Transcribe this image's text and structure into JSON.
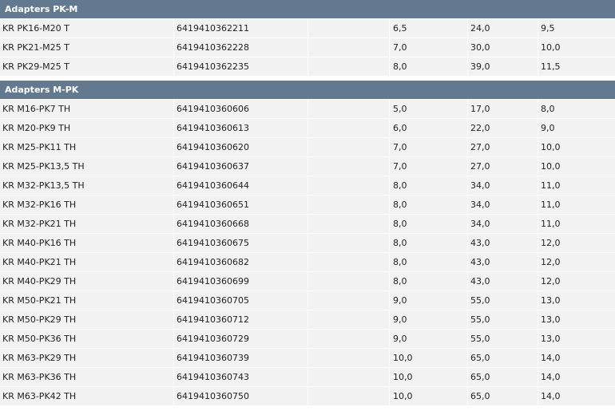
{
  "sections": [
    {
      "title": "Adapters PK-M",
      "rows": [
        {
          "name": "KR PK16-M20 T",
          "code": "6419410362211",
          "empty": "",
          "v1": "6,5",
          "v2": "24,0",
          "v3": "9,5"
        },
        {
          "name": "KR PK21-M25 T",
          "code": "6419410362228",
          "empty": "",
          "v1": "7,0",
          "v2": "30,0",
          "v3": "10,0"
        },
        {
          "name": "KR PK29-M25 T",
          "code": "6419410362235",
          "empty": "",
          "v1": "8,0",
          "v2": "39,0",
          "v3": "11,5"
        }
      ]
    },
    {
      "title": "Adapters M-PK",
      "rows": [
        {
          "name": "KR M16-PK7 TH",
          "code": "6419410360606",
          "empty": "",
          "v1": "5,0",
          "v2": "17,0",
          "v3": "8,0"
        },
        {
          "name": "KR M20-PK9 TH",
          "code": "6419410360613",
          "empty": "",
          "v1": "6,0",
          "v2": "22,0",
          "v3": "9,0"
        },
        {
          "name": "KR M25-PK11 TH",
          "code": "6419410360620",
          "empty": "",
          "v1": "7,0",
          "v2": "27,0",
          "v3": "10,0"
        },
        {
          "name": "KR M25-PK13,5 TH",
          "code": "6419410360637",
          "empty": "",
          "v1": "7,0",
          "v2": "27,0",
          "v3": "10,0"
        },
        {
          "name": "KR M32-PK13,5 TH",
          "code": "6419410360644",
          "empty": "",
          "v1": "8,0",
          "v2": "34,0",
          "v3": "11,0"
        },
        {
          "name": "KR M32-PK16 TH",
          "code": "6419410360651",
          "empty": "",
          "v1": "8,0",
          "v2": "34,0",
          "v3": "11,0"
        },
        {
          "name": "KR M32-PK21 TH",
          "code": "6419410360668",
          "empty": "",
          "v1": "8,0",
          "v2": "34,0",
          "v3": "11,0"
        },
        {
          "name": "KR M40-PK16 TH",
          "code": "6419410360675",
          "empty": "",
          "v1": "8,0",
          "v2": "43,0",
          "v3": "12,0"
        },
        {
          "name": "KR M40-PK21 TH",
          "code": "6419410360682",
          "empty": "",
          "v1": "8,0",
          "v2": "43,0",
          "v3": "12,0"
        },
        {
          "name": "KR M40-PK29 TH",
          "code": "6419410360699",
          "empty": "",
          "v1": "8,0",
          "v2": "43,0",
          "v3": "12,0"
        },
        {
          "name": "KR M50-PK21 TH",
          "code": "6419410360705",
          "empty": "",
          "v1": "9,0",
          "v2": "55,0",
          "v3": "13,0"
        },
        {
          "name": "KR M50-PK29 TH",
          "code": "6419410360712",
          "empty": "",
          "v1": "9,0",
          "v2": "55,0",
          "v3": "13,0"
        },
        {
          "name": "KR M50-PK36 TH",
          "code": "6419410360729",
          "empty": "",
          "v1": "9,0",
          "v2": "55,0",
          "v3": "13,0"
        },
        {
          "name": "KR M63-PK29 TH",
          "code": "6419410360739",
          "empty": "",
          "v1": "10,0",
          "v2": "65,0",
          "v3": "14,0"
        },
        {
          "name": "KR M63-PK36 TH",
          "code": "6419410360743",
          "empty": "",
          "v1": "10,0",
          "v2": "65,0",
          "v3": "14,0"
        },
        {
          "name": "KR M63-PK42 TH",
          "code": "6419410360750",
          "empty": "",
          "v1": "10,0",
          "v2": "65,0",
          "v3": "14,0"
        }
      ]
    }
  ],
  "colors": {
    "header_bg": "#637990",
    "header_text": "#ffffff",
    "row_bg": "#f2f2f2"
  }
}
